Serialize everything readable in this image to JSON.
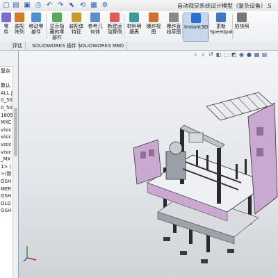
{
  "window": {
    "title": "自动视觉系统设计模型（复杂设备）.S"
  },
  "ribbon": {
    "buttons": [
      {
        "label": "零\n件",
        "icon": "assembly-icon"
      },
      {
        "label": "装配阵列",
        "icon": "pattern-icon"
      },
      {
        "label": "移动零\n部件",
        "icon": "move-component-icon"
      },
      {
        "label": "显示隐\n藏的零\n部件",
        "icon": "show-hidden-icon"
      },
      {
        "label": "装配体\n特征",
        "icon": "assembly-feature-icon"
      },
      {
        "label": "参考几\n何体",
        "icon": "reference-geometry-icon"
      },
      {
        "label": "新建运\n动算例",
        "icon": "motion-study-icon"
      },
      {
        "label": "材料明\n细表",
        "icon": "bom-icon"
      },
      {
        "label": "爆炸视\n图",
        "icon": "exploded-view-icon"
      },
      {
        "label": "爆炸直\n线草图",
        "icon": "explode-line-icon"
      },
      {
        "label": "Instant3D",
        "icon": "instant3d-icon"
      },
      {
        "label": "更新\nSpeedpak",
        "icon": "speedpak-icon"
      },
      {
        "label": "拍快照",
        "icon": "snapshot-icon"
      }
    ]
  },
  "tabs": [
    {
      "label": "评估"
    },
    {
      "label": "SOLIDWORKS 插件"
    },
    {
      "label": "SOLIDWORKS MBD"
    }
  ],
  "tree": {
    "header": "复杂",
    "rows": [
      "",
      "数认",
      "ALL J",
      "0_50",
      "0_50",
      "1805",
      "MXC",
      "visic",
      "visic",
      "visic",
      "visic",
      "_MX",
      "1> (",
      ">(数",
      "OSH",
      "MER",
      "OSH",
      "OLD",
      "OSH"
    ]
  },
  "viewport": {
    "tools": [
      "zoom-fit-icon",
      "zoom-area-icon",
      "previous-view-icon",
      "section-view-icon",
      "view-orientation-icon",
      "display-style-icon",
      "hide-show-icon",
      "appearance-icon",
      "scene-icon",
      "view-settings-icon"
    ],
    "colors": {
      "frame": "#2a2a2a",
      "panel": "#c9a9cf",
      "metal": "#d9dbe0",
      "base": "#3a3a3a"
    }
  }
}
